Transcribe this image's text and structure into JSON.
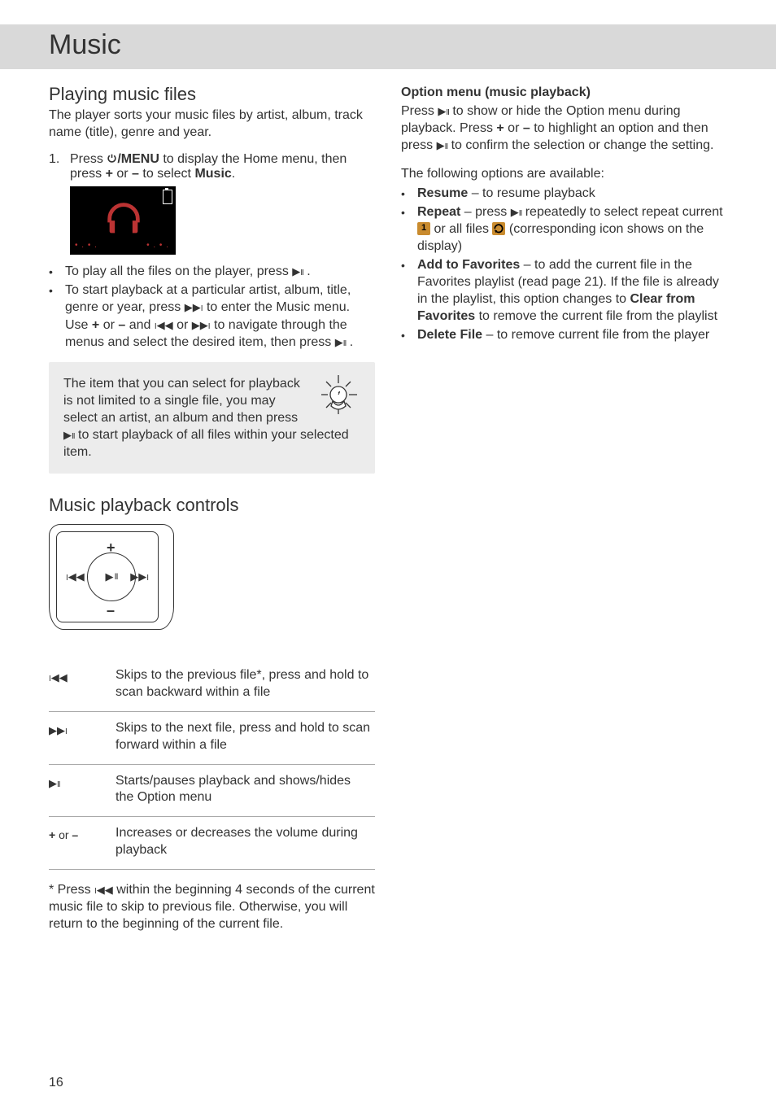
{
  "title": "Music",
  "left": {
    "h_play": "Playing music files",
    "play_intro": "The player sorts your music files by artist, album, track name (title), genre and year.",
    "step1_num": "1.",
    "step1_a": "Press ",
    "step1_menu": "/MENU",
    "step1_b": " to display the Home menu, then press ",
    "step1_plus": "+",
    "step1_or": " or ",
    "step1_minus": "–",
    "step1_c": " to select ",
    "step1_music": "Music",
    "step1_d": ".",
    "bul1_a": "To play all the files on the player, press ",
    "bul1_b": " .",
    "bul2_a": "To start playback at a particular artist, album, title, genre or year, press ",
    "bul2_b": " to enter the Music menu. Use ",
    "bul2_plus": "+",
    "bul2_or1": " or ",
    "bul2_minus": "–",
    "bul2_c": " and ",
    "bul2_or2": " or ",
    "bul2_d": " to navigate through the menus and select the desired item, then press ",
    "bul2_e": " .",
    "tip_a": "The item that you can select for playback is not limited to a single file, you may select an artist, an album and then press ",
    "tip_b": " to start playback of all files within your selected item.",
    "h_controls": "Music playback controls",
    "tbl": {
      "r1": "Skips to the previous file*, press and hold to scan backward within a file",
      "r2": "Skips to the next file, press and hold to scan forward within a file",
      "r3": "Starts/pauses playback and shows/hides the Option menu",
      "r4_sym_a": "+",
      "r4_sym_or": " or ",
      "r4_sym_b": "–",
      "r4": "Increases or decreases the volume during playback"
    },
    "foot_a": "* Press ",
    "foot_b": " within the beginning 4 seconds of the current music file to skip to previous file. Otherwise, you will return to the beginning of the current file."
  },
  "right": {
    "h_opt": "Option menu (music playback)",
    "opt_a": "Press ",
    "opt_b": " to show or hide the Option menu during playback. Press ",
    "opt_plus": "+",
    "opt_or": " or ",
    "opt_minus": "–",
    "opt_c": " to highlight an option and then press ",
    "opt_d": " to confirm the selection or change the setting.",
    "avail": "The following options are available:",
    "li1_b": "Resume",
    "li1_t": " – to resume playback",
    "li2_b": "Repeat",
    "li2_a": " – press ",
    "li2_c": " repeatedly to select repeat current ",
    "li2_d": " or all files ",
    "li2_e": " (corresponding icon shows on the display)",
    "li3_b": "Add to Favorites",
    "li3_a": " – to add the current file in the Favorites playlist (read page 21). If the file is already in the playlist, this option changes to ",
    "li3_c": "Clear from Favorites",
    "li3_d": " to remove the current file from the playlist",
    "li4_b": "Delete File",
    "li4_t": " – to remove current file from the player"
  },
  "page_num": "16"
}
